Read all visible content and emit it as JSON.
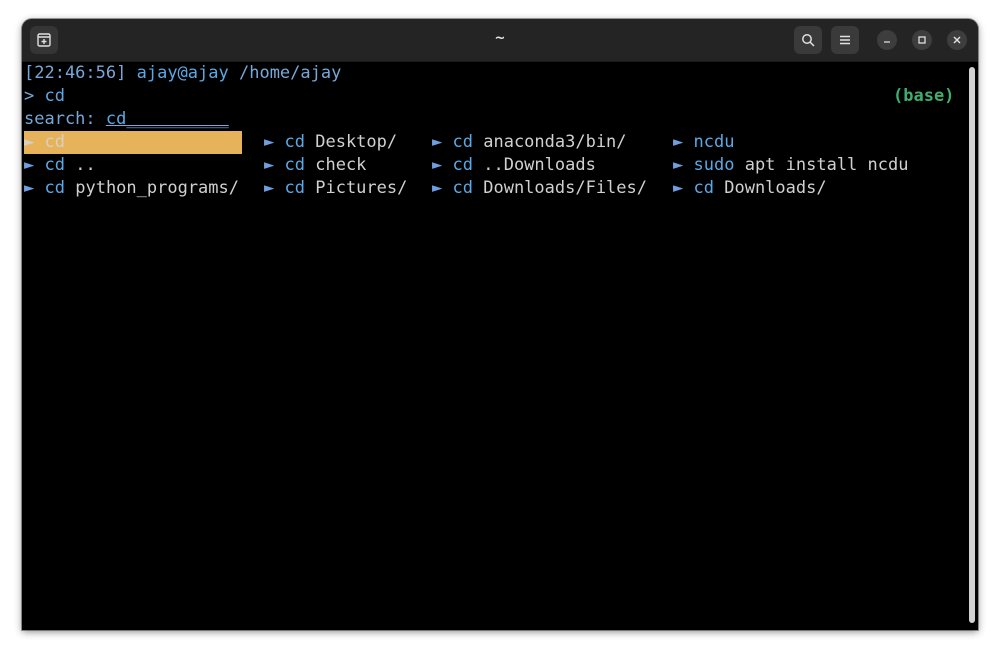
{
  "window": {
    "title": "~"
  },
  "icons": {
    "new_tab": "new-tab-icon",
    "search": "search-icon",
    "menu": "hamburger-menu-icon",
    "minimize": "minimize-icon",
    "maximize": "maximize-icon",
    "close": "close-icon"
  },
  "terminal": {
    "prompt": {
      "time": "[22:46:56]",
      "user_host": "ajay@ajay",
      "path": "/home/ajay"
    },
    "command_line": {
      "symbol": ">",
      "command": "cd",
      "env": "(base)"
    },
    "search": {
      "label": "search:",
      "value": "cd",
      "trail": "__________"
    },
    "results": [
      {
        "arrow": "►",
        "cmd": "cd",
        "arg": "",
        "selected": true
      },
      {
        "arrow": "►",
        "cmd": "cd",
        "arg": "Desktop/"
      },
      {
        "arrow": "►",
        "cmd": "cd",
        "arg": "anaconda3/bin/"
      },
      {
        "arrow": "►",
        "cmd": "ncdu",
        "arg": ""
      },
      {
        "arrow": "►",
        "cmd": "cd",
        "arg": ".."
      },
      {
        "arrow": "►",
        "cmd": "cd",
        "arg": "check"
      },
      {
        "arrow": "►",
        "cmd": "cd",
        "arg": "..Downloads"
      },
      {
        "arrow": "►",
        "cmd": "sudo",
        "arg": "apt install ncdu"
      },
      {
        "arrow": "►",
        "cmd": "cd",
        "arg": "python_programs/"
      },
      {
        "arrow": "►",
        "cmd": "cd",
        "arg": "Pictures/"
      },
      {
        "arrow": "►",
        "cmd": "cd",
        "arg": "Downloads/Files/"
      },
      {
        "arrow": "►",
        "cmd": "cd",
        "arg": "Downloads/"
      }
    ]
  },
  "colors": {
    "background": "#000000",
    "titlebar": "#242424",
    "prompt_blue": "#77a8d9",
    "env_green": "#3fae6e",
    "selection": "#e6b25a"
  }
}
